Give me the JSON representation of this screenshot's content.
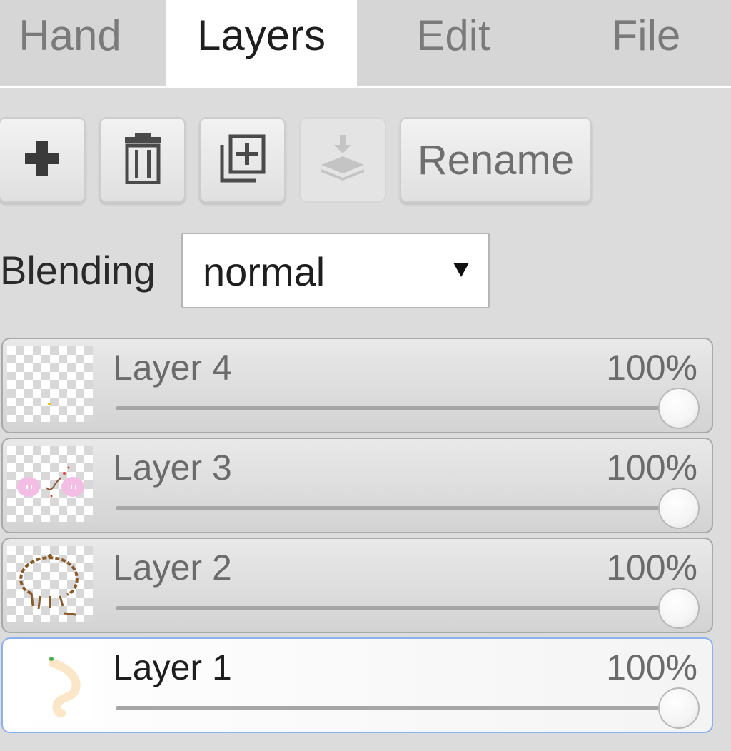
{
  "tabs": [
    {
      "label": "Hand",
      "active": false
    },
    {
      "label": "Layers",
      "active": true
    },
    {
      "label": "Edit",
      "active": false
    },
    {
      "label": "File",
      "active": false
    }
  ],
  "toolbar": {
    "add_icon": "plus-icon",
    "delete_icon": "trash-icon",
    "duplicate_icon": "duplicate-icon",
    "merge_down_icon": "merge-down-icon",
    "merge_down_disabled": true,
    "rename_label": "Rename"
  },
  "blending": {
    "label": "Blending",
    "value": "normal"
  },
  "layers": [
    {
      "name": "Layer 4",
      "opacity_label": "100%",
      "opacity": 1.0,
      "selected": false
    },
    {
      "name": "Layer 3",
      "opacity_label": "100%",
      "opacity": 1.0,
      "selected": false
    },
    {
      "name": "Layer 2",
      "opacity_label": "100%",
      "opacity": 1.0,
      "selected": false
    },
    {
      "name": "Layer 1",
      "opacity_label": "100%",
      "opacity": 1.0,
      "selected": true
    }
  ],
  "colors": {
    "selected_border": "#8fb0ee",
    "tab_active_bg": "#ffffff",
    "panel_bg": "#dcdcdc"
  }
}
